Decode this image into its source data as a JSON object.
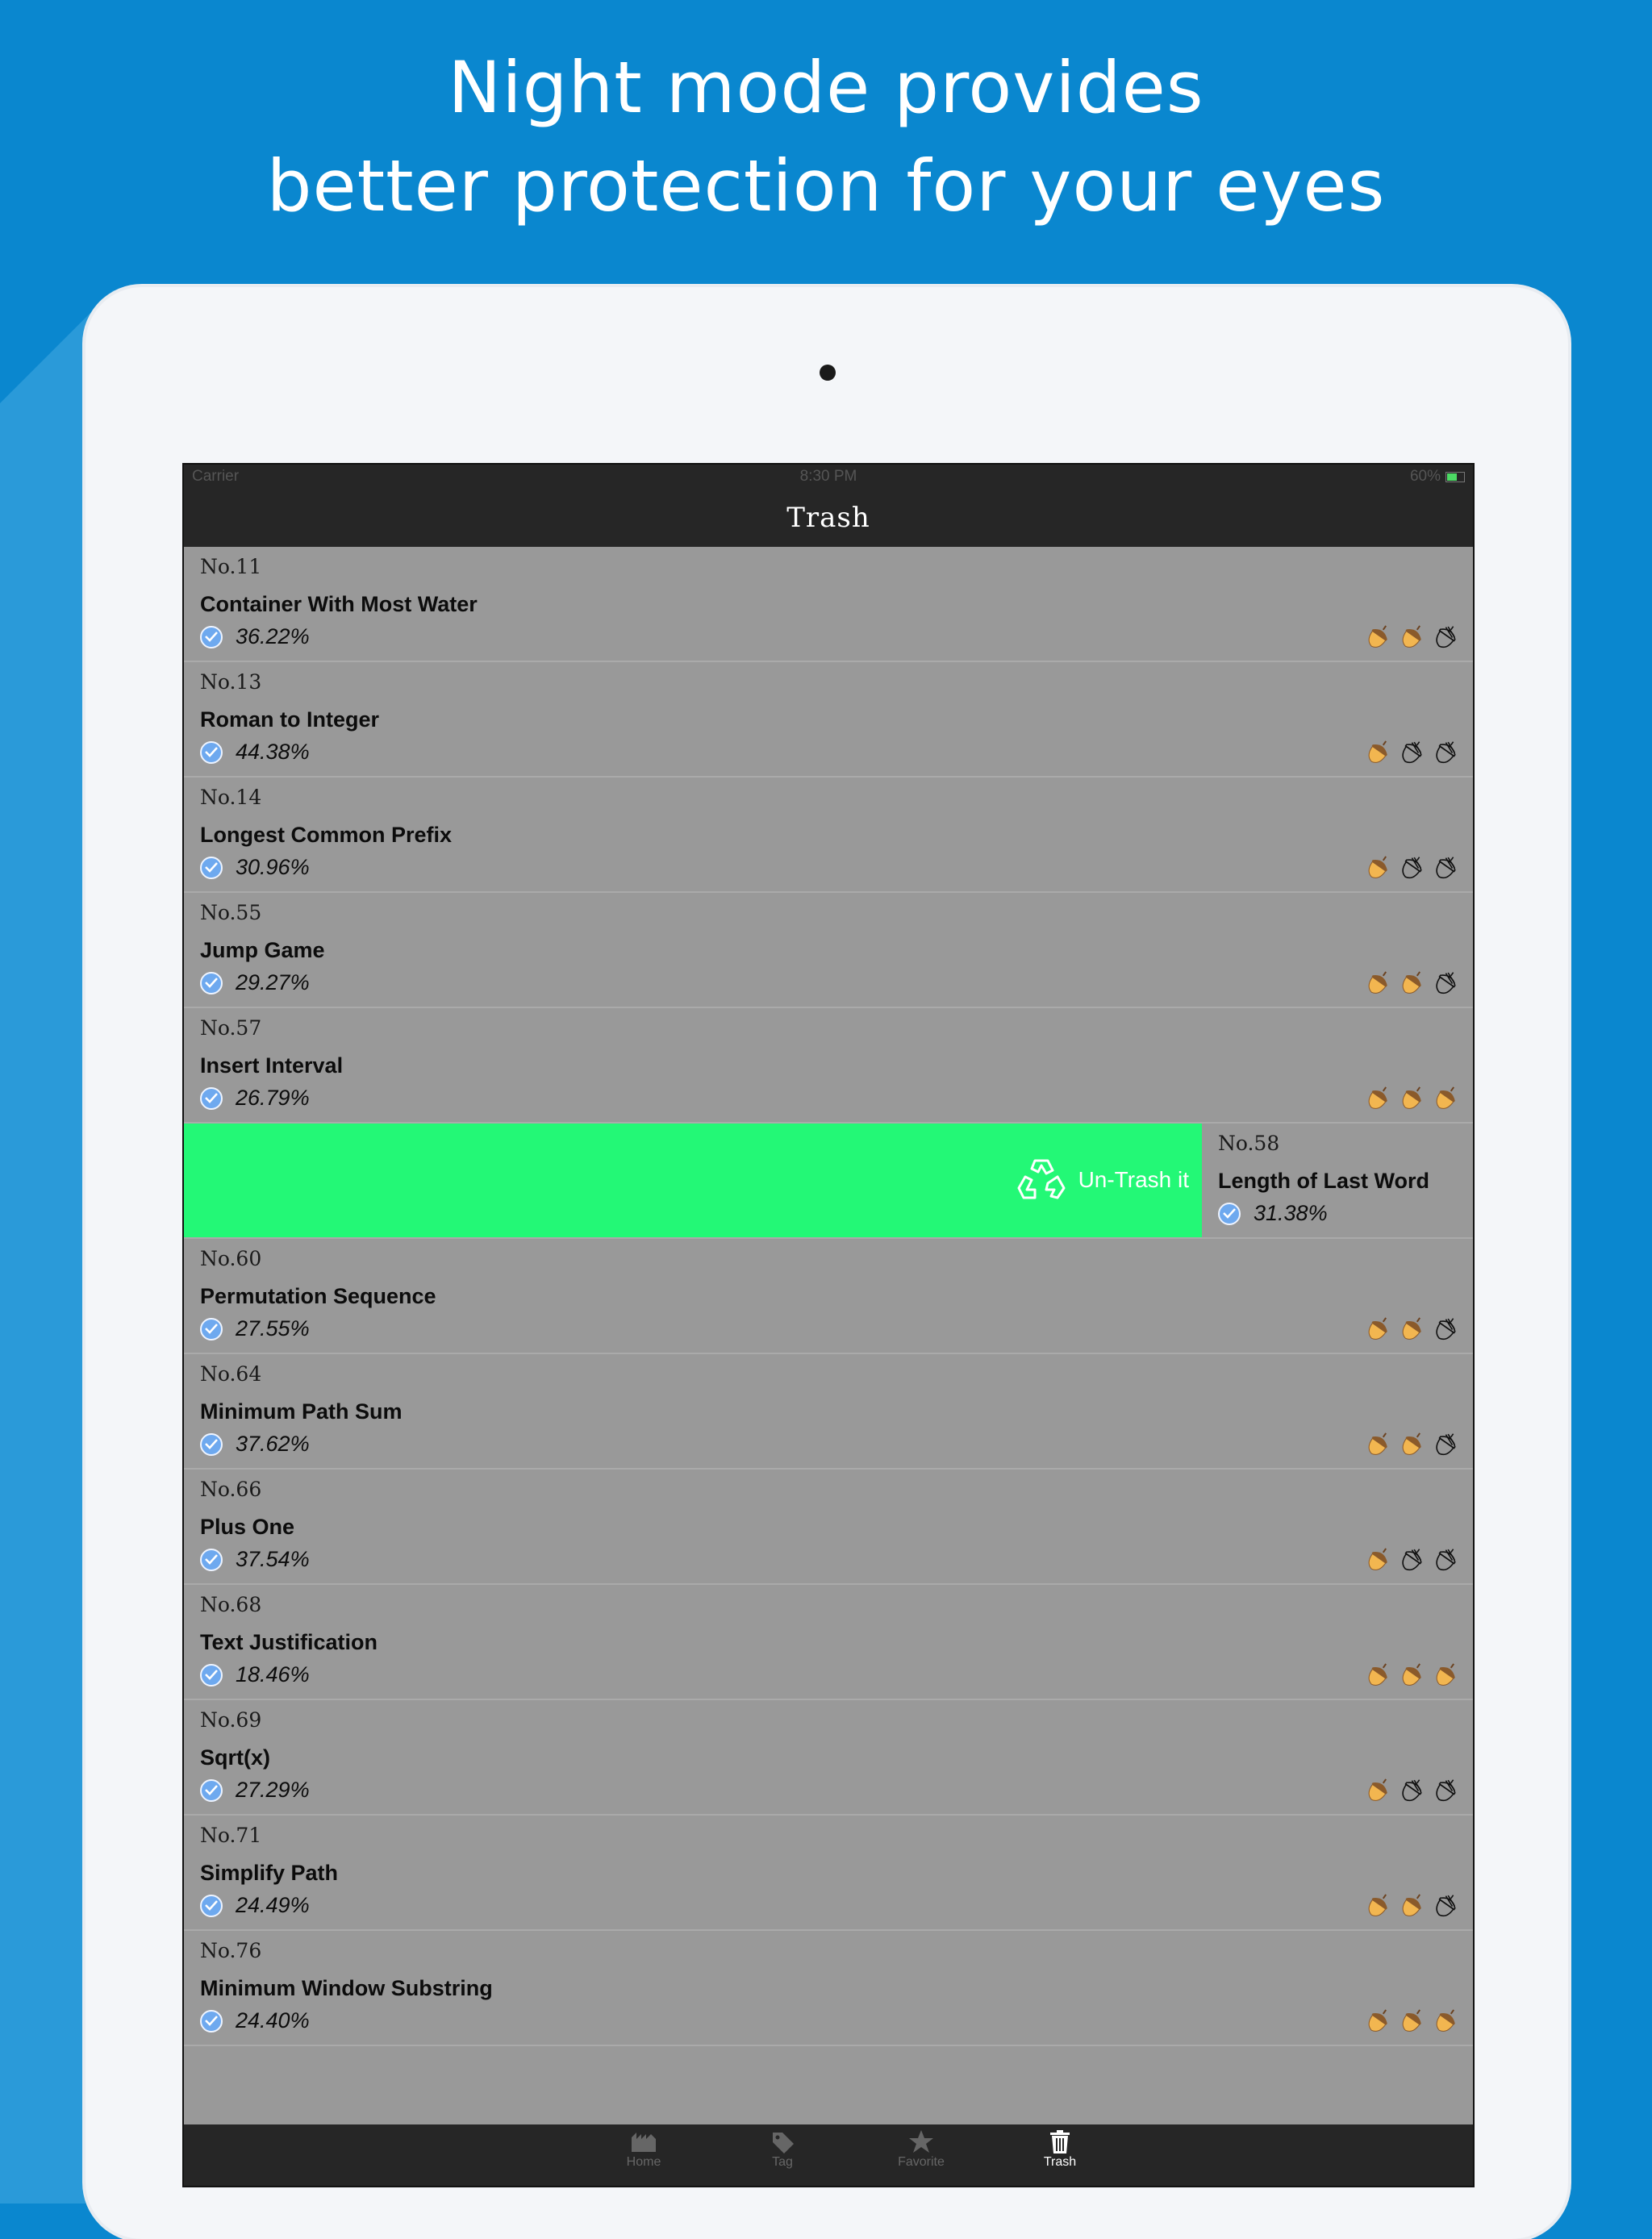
{
  "headline": {
    "line1": "Night mode provides",
    "line2": "better protection for your eyes"
  },
  "status": {
    "carrier": "Carrier",
    "time": "8:30 PM",
    "battery": "60%"
  },
  "nav": {
    "title": "Trash"
  },
  "colors": {
    "background": "#0a87cf",
    "swipe_green": "#23f876",
    "check_blue": "#6ea9ef"
  },
  "rows": [
    {
      "num": "No.11",
      "title": "Container With Most Water",
      "rate": "36.22%",
      "acorns": [
        "filled",
        "filled",
        "empty"
      ]
    },
    {
      "num": "No.13",
      "title": "Roman to Integer",
      "rate": "44.38%",
      "acorns": [
        "filled",
        "empty",
        "empty"
      ]
    },
    {
      "num": "No.14",
      "title": "Longest Common Prefix",
      "rate": "30.96%",
      "acorns": [
        "filled",
        "empty",
        "empty"
      ]
    },
    {
      "num": "No.55",
      "title": "Jump Game",
      "rate": "29.27%",
      "acorns": [
        "filled",
        "filled",
        "empty"
      ]
    },
    {
      "num": "No.57",
      "title": "Insert Interval",
      "rate": "26.79%",
      "acorns": [
        "filled",
        "filled",
        "filled"
      ]
    }
  ],
  "swipe_row": {
    "action_label": "Un-Trash it",
    "num": "No.58",
    "title": "Length of Last Word",
    "rate": "31.38%"
  },
  "rows2": [
    {
      "num": "No.60",
      "title": "Permutation Sequence",
      "rate": "27.55%",
      "acorns": [
        "filled",
        "filled",
        "empty"
      ]
    },
    {
      "num": "No.64",
      "title": "Minimum Path Sum",
      "rate": "37.62%",
      "acorns": [
        "filled",
        "filled",
        "empty"
      ]
    },
    {
      "num": "No.66",
      "title": "Plus One",
      "rate": "37.54%",
      "acorns": [
        "filled",
        "empty",
        "empty"
      ]
    },
    {
      "num": "No.68",
      "title": "Text Justification",
      "rate": "18.46%",
      "acorns": [
        "filled",
        "filled",
        "filled"
      ]
    },
    {
      "num": "No.69",
      "title": "Sqrt(x)",
      "rate": "27.29%",
      "acorns": [
        "filled",
        "empty",
        "empty"
      ]
    },
    {
      "num": "No.71",
      "title": "Simplify Path",
      "rate": "24.49%",
      "acorns": [
        "filled",
        "filled",
        "empty"
      ]
    },
    {
      "num": "No.76",
      "title": "Minimum Window Substring",
      "rate": "24.40%",
      "acorns": [
        "filled",
        "filled",
        "filled"
      ]
    }
  ],
  "tabs": [
    {
      "label": "Home",
      "icon": "home-icon"
    },
    {
      "label": "Tag",
      "icon": "tag-icon"
    },
    {
      "label": "Favorite",
      "icon": "star-icon"
    },
    {
      "label": "Trash",
      "icon": "trash-icon",
      "active": true
    }
  ]
}
